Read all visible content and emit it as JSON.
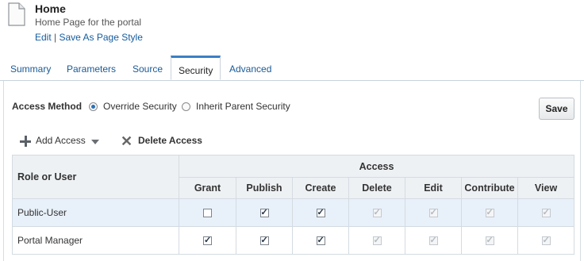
{
  "header": {
    "title": "Home",
    "subtitle": "Home Page for the portal",
    "edit_link": "Edit",
    "separator": "|",
    "save_style_link": "Save As Page Style"
  },
  "tabs": [
    "Summary",
    "Parameters",
    "Source",
    "Security",
    "Advanced"
  ],
  "active_tab": "Security",
  "access_method": {
    "label": "Access Method",
    "option_override": "Override Security",
    "option_inherit": "Inherit Parent Security",
    "selected": "Override Security"
  },
  "save_button": "Save",
  "toolbar": {
    "add_access": "Add Access",
    "delete_access": "Delete Access"
  },
  "table": {
    "role_header": "Role or User",
    "group_header": "Access",
    "columns": [
      "Grant",
      "Publish",
      "Create",
      "Delete",
      "Edit",
      "Contribute",
      "View"
    ],
    "rows": [
      {
        "name": "Public-User",
        "checked": [
          false,
          true,
          true,
          true,
          true,
          true,
          true
        ],
        "enabled": [
          true,
          true,
          true,
          false,
          false,
          false,
          false
        ]
      },
      {
        "name": "Portal Manager",
        "checked": [
          true,
          true,
          true,
          true,
          true,
          true,
          true
        ],
        "enabled": [
          true,
          true,
          true,
          false,
          false,
          false,
          false
        ]
      }
    ]
  }
}
